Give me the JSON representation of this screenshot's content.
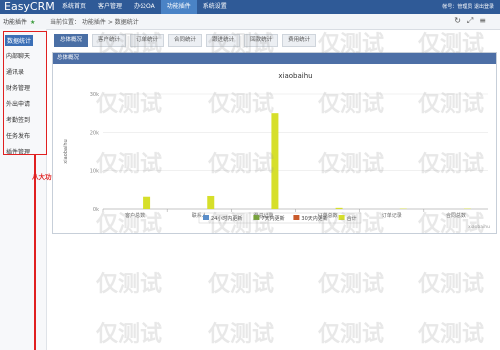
{
  "app": {
    "logo": "EasyCRM"
  },
  "nav": {
    "items": [
      "系统首页",
      "客户管理",
      "办公OA",
      "功能插件",
      "系统设置"
    ],
    "active_index": 3
  },
  "topright": {
    "text": "帐号：管理员   退出登录"
  },
  "subbar": {
    "section_title": "功能插件",
    "breadcrumb": "当前位置： 功能插件 > 数据统计",
    "tools": [
      "↻",
      "⤢",
      "≡"
    ]
  },
  "sidebar": {
    "items": [
      "数据统计",
      "内部聊天",
      "通讯录",
      "财务管理",
      "外出申请",
      "考勤签到",
      "任务发布",
      "插件管理"
    ],
    "active_index": 0
  },
  "annotation": {
    "text": "八大功能插件齐全"
  },
  "tabs": {
    "items": [
      "总体概况",
      "客户统计",
      "订单统计",
      "合同统计",
      "跟进统计",
      "回款统计",
      "费用统计"
    ],
    "active_index": 0
  },
  "panel": {
    "title": "总体概况"
  },
  "chart_data": {
    "type": "bar",
    "title": "xiaobaihu",
    "ylabel": "xiaobaihu",
    "credit": "xiaobaihu",
    "y_ticks": [
      "0k",
      "10k",
      "20k",
      "30k"
    ],
    "ylim": [
      0,
      30000
    ],
    "categories": [
      "客户总数",
      "联系人",
      "跟进记录",
      "订单总数",
      "订单记录",
      "合同总数"
    ],
    "series": [
      {
        "name": "24小时内更新",
        "color": "#5b8ec9",
        "values": [
          0,
          0,
          0,
          0,
          0,
          0
        ]
      },
      {
        "name": "7天内更新",
        "color": "#77a33a",
        "values": [
          0,
          0,
          0,
          0,
          0,
          0
        ]
      },
      {
        "name": "30天内更新",
        "color": "#c95a2b",
        "values": [
          0,
          0,
          0,
          0,
          0,
          0
        ]
      },
      {
        "name": "合计",
        "color": "#d6df2a",
        "values": [
          3200,
          3400,
          25000,
          300,
          100,
          100
        ]
      }
    ],
    "colors": {
      "grid": "#e6e6e6",
      "axis": "#999999"
    }
  },
  "watermark": {
    "text": "仅测试"
  }
}
